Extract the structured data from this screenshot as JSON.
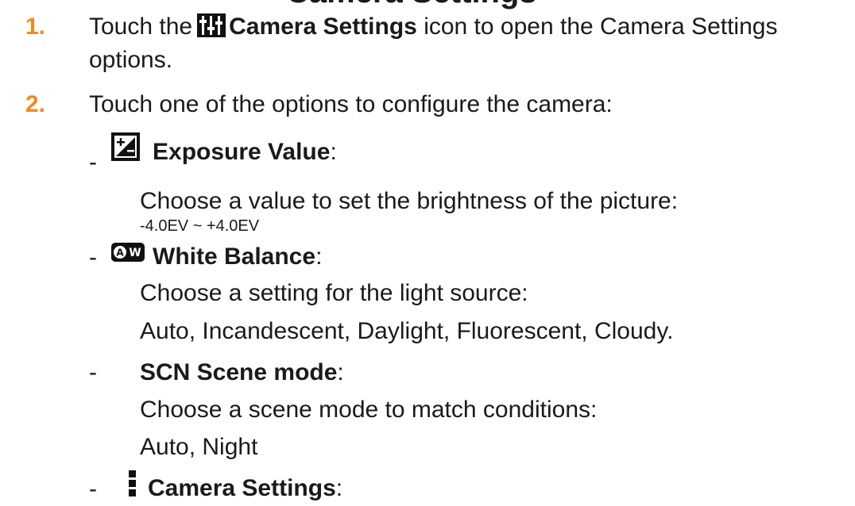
{
  "heading": "Camera Settings",
  "steps": [
    {
      "number": "1.",
      "line1_before": "Touch the",
      "icon": "camera-settings-sliders-icon",
      "line1_bold": "Camera Settings",
      "line1_after": "icon to open the Camera Settings",
      "line2": "options."
    },
    {
      "number": "2.",
      "line1": "Touch one of the options to configure the camera:"
    }
  ],
  "options": [
    {
      "dash": "-",
      "icon": "exposure-value-icon",
      "title": "Exposure Value",
      "colon": ":",
      "description": "Choose a value to set the brightness of the picture:",
      "detail": "-4.0EV ~ +4.0EV"
    },
    {
      "dash": "-",
      "icon": "white-balance-icon",
      "title": "White Balance",
      "colon": ":",
      "description": "Choose a setting for the light source:",
      "detail": "Auto, Incandescent, Daylight, Fluorescent, Cloudy."
    },
    {
      "dash": "-",
      "title": "SCN Scene mode",
      "colon": ":",
      "description": "Choose a scene mode to match conditions:",
      "detail": "Auto, Night"
    },
    {
      "dash": "-",
      "icon": "camera-settings-more-icon",
      "title": "Camera Settings",
      "colon": ":"
    }
  ]
}
